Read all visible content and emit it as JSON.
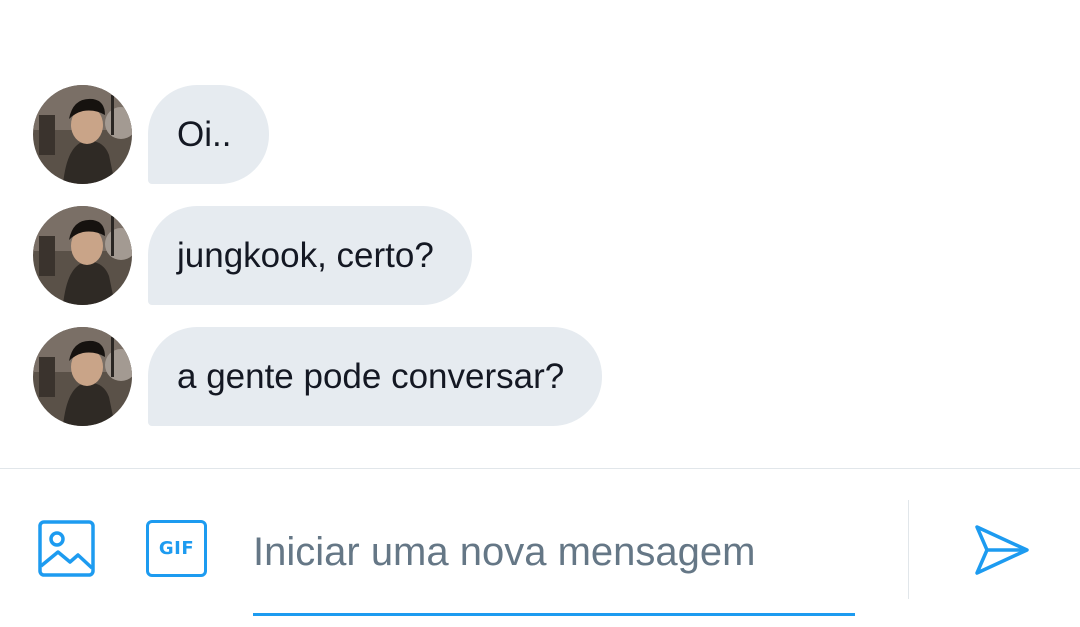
{
  "conversation": {
    "messages": [
      {
        "sender": "avatar",
        "text": "Oi.."
      },
      {
        "sender": "avatar",
        "text": "jungkook, certo?"
      },
      {
        "sender": "avatar",
        "text": "a gente pode conversar?"
      }
    ]
  },
  "composer": {
    "image_icon": "image-icon",
    "gif_label": "GIF",
    "input_placeholder": "Iniciar uma nova mensagem",
    "input_value": "",
    "send_icon": "send-icon"
  },
  "colors": {
    "bubble_bg": "#e6ebf0",
    "accent": "#1d9bf0",
    "text": "#141823",
    "placeholder": "#657786",
    "divider": "#e1e6ea"
  }
}
